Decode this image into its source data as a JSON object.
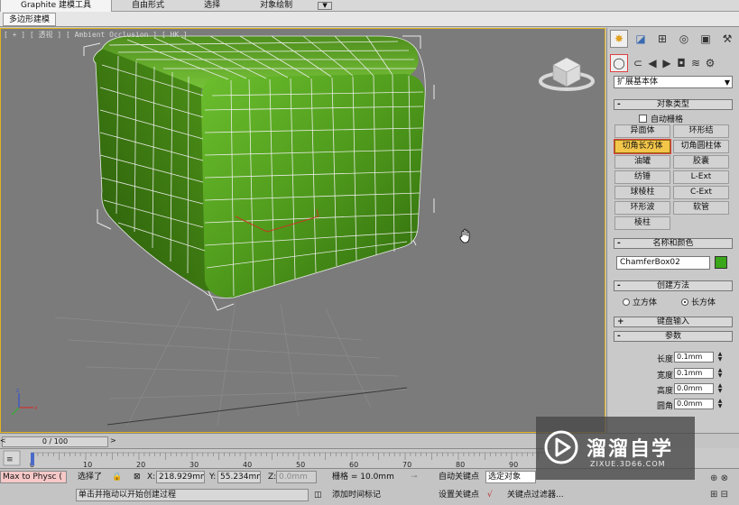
{
  "ribbon": {
    "tabs": [
      "Graphite 建模工具",
      "自由形式",
      "选择",
      "对象绘制"
    ],
    "sub_tab": "多边形建模"
  },
  "viewport": {
    "label": "[ + ] [ 透视 ] [ Ambient Occlusion ] [ HK ]"
  },
  "command_panel": {
    "category_dropdown": "扩展基本体",
    "rollouts": {
      "object_type": "对象类型",
      "name_color": "名称和颜色",
      "creation_method": "创建方法",
      "keyboard_entry": "键盘输入",
      "parameters": "参数"
    },
    "auto_grid": "自动栅格",
    "object_buttons": [
      "异面体",
      "环形结",
      "切角长方体",
      "切角圆柱体",
      "油罐",
      "胶囊",
      "纺锤",
      "L-Ext",
      "球棱柱",
      "C-Ext",
      "环形波",
      "软管",
      "棱柱"
    ],
    "active_object_button": "切角长方体",
    "object_name": "ChamferBox02",
    "object_color": "#3aa619",
    "creation_methods": [
      "立方体",
      "长方体"
    ],
    "selected_creation_method": "长方体",
    "params": [
      {
        "label": "长度:",
        "value": "0.1mm"
      },
      {
        "label": "宽度:",
        "value": "0.1mm"
      },
      {
        "label": "高度:",
        "value": "0.0mm"
      },
      {
        "label": "圆角:",
        "value": "0.0mm"
      }
    ]
  },
  "timeline": {
    "frame_display": "0 / 100",
    "ticks": [
      "0",
      "10",
      "20",
      "30",
      "40",
      "50",
      "60",
      "70",
      "80",
      "90"
    ]
  },
  "status_bar": {
    "script_listener": "Max to Physc (",
    "selection_status": "选择了",
    "x_label": "X:",
    "x_value": "218.929mm",
    "y_label": "Y:",
    "y_value": "55.234mm",
    "z_label": "Z:",
    "z_value": "0.0mm",
    "grid": "栅格 = 10.0mm",
    "auto_key": "自动关键点",
    "selected_object": "选定对象",
    "set_key": "设置关键点",
    "key_filters": "关键点过滤器...",
    "prompt": "单击并拖动以开始创建过程",
    "add_time_tag": "添加时间标记"
  },
  "watermark": {
    "brand": "溜溜自学",
    "url": "ZIXUE.3D66.COM"
  }
}
